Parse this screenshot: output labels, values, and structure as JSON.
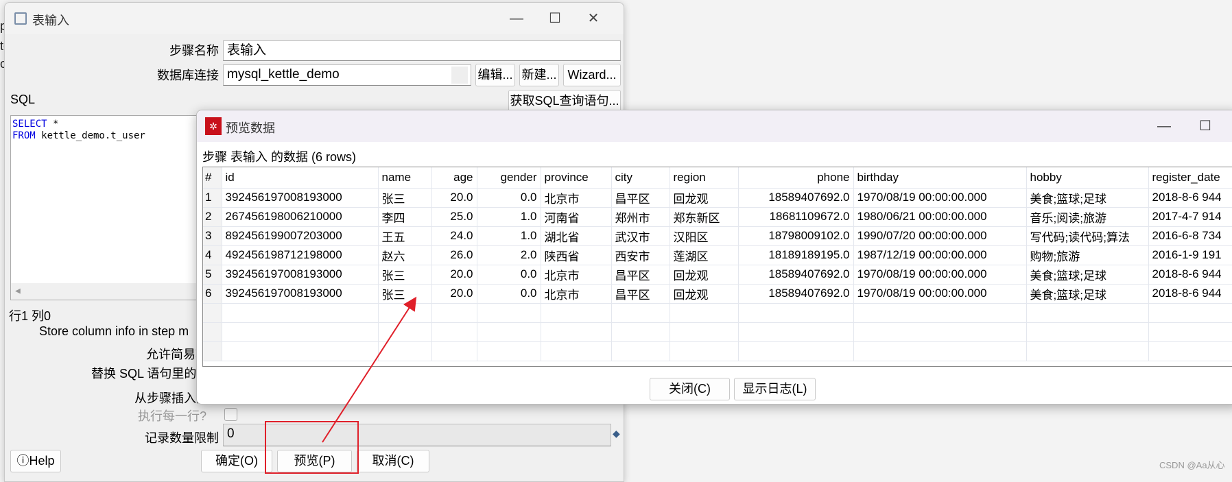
{
  "background_fragments": [
    "p",
    "te",
    "o"
  ],
  "main_dialog": {
    "title": "表输入",
    "step_name_label": "步骤名称",
    "step_name_value": "表输入",
    "db_conn_label": "数据库连接",
    "db_conn_value": "mysql_kettle_demo",
    "edit_btn": "编辑...",
    "new_btn": "新建...",
    "wizard_btn": "Wizard...",
    "sql_label": "SQL",
    "get_sql_btn": "获取SQL查询语句...",
    "sql_line1_kw": "SELECT",
    "sql_line1_rest": " *",
    "sql_line2_kw": "FROM",
    "sql_line2_rest": " kettle_demo.t_user",
    "cursor_pos": "行1 列0",
    "store_column_label": "Store column info in step m",
    "lazy_conv_label": "允许简易转",
    "replace_vars_label": "替换 SQL 语句里的变",
    "insert_from_step_label": "从步骤插入数",
    "execute_each_row_label": "执行每一行?",
    "limit_label": "记录数量限制",
    "limit_value": "0",
    "help_btn": "Help",
    "ok_btn": "确定(O)",
    "preview_btn": "预览(P)",
    "cancel_btn": "取消(C)"
  },
  "preview_dialog": {
    "title": "预览数据",
    "subtitle": "步骤 表输入 的数据  (6 rows)",
    "columns": [
      "#",
      "id",
      "name",
      "age",
      "gender",
      "province",
      "city",
      "region",
      "phone",
      "birthday",
      "hobby",
      "register_date"
    ],
    "rows": [
      [
        "1",
        "392456197008193000",
        "张三",
        "20.0",
        "0.0",
        "北京市",
        "昌平区",
        "回龙观",
        "18589407692.0",
        "1970/08/19 00:00:00.000",
        "美食;篮球;足球",
        "2018-8-6 944"
      ],
      [
        "2",
        "267456198006210000",
        "李四",
        "25.0",
        "1.0",
        "河南省",
        "郑州市",
        "郑东新区",
        "18681109672.0",
        "1980/06/21 00:00:00.000",
        "音乐;阅读;旅游",
        "2017-4-7 914"
      ],
      [
        "3",
        "892456199007203000",
        "王五",
        "24.0",
        "1.0",
        "湖北省",
        "武汉市",
        "汉阳区",
        "18798009102.0",
        "1990/07/20 00:00:00.000",
        "写代码;读代码;算法",
        "2016-6-8 734"
      ],
      [
        "4",
        "492456198712198000",
        "赵六",
        "26.0",
        "2.0",
        "陕西省",
        "西安市",
        "莲湖区",
        "18189189195.0",
        "1987/12/19 00:00:00.000",
        "购物;旅游",
        "2016-1-9 191"
      ],
      [
        "5",
        "392456197008193000",
        "张三",
        "20.0",
        "0.0",
        "北京市",
        "昌平区",
        "回龙观",
        "18589407692.0",
        "1970/08/19 00:00:00.000",
        "美食;篮球;足球",
        "2018-8-6 944"
      ],
      [
        "6",
        "392456197008193000",
        "张三",
        "20.0",
        "0.0",
        "北京市",
        "昌平区",
        "回龙观",
        "18589407692.0",
        "1970/08/19 00:00:00.000",
        "美食;篮球;足球",
        "2018-8-6 944"
      ]
    ],
    "close_btn": "关闭(C)",
    "show_log_btn": "显示日志(L)"
  },
  "annotation_color": "#e0202a",
  "watermark": "CSDN @Aa从心"
}
